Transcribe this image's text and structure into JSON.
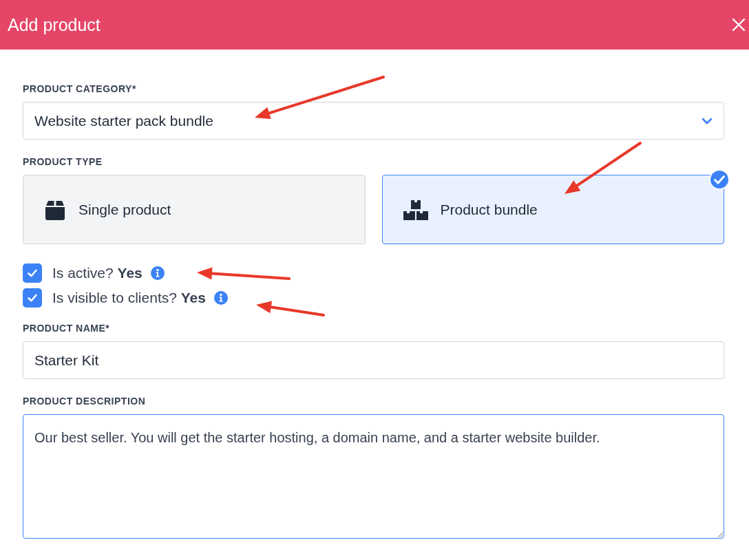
{
  "window": {
    "title": "Add product"
  },
  "category": {
    "label": "PRODUCT CATEGORY*",
    "value": "Website starter pack bundle"
  },
  "product_type": {
    "label": "PRODUCT TYPE",
    "options": [
      {
        "kind": "single",
        "label": "Single product",
        "selected": false
      },
      {
        "kind": "bundle",
        "label": "Product bundle",
        "selected": true
      }
    ]
  },
  "toggles": [
    {
      "label": "Is active? **Yes**",
      "checked": true
    },
    {
      "label": "Is visible to clients? **Yes**",
      "checked": true
    }
  ],
  "name": {
    "label": "PRODUCT NAME*",
    "value": "Starter Kit"
  },
  "description": {
    "label": "PRODUCT DESCRIPTION",
    "value": "Our best seller. You will get the starter hosting, a domain name, and a starter website builder."
  }
}
